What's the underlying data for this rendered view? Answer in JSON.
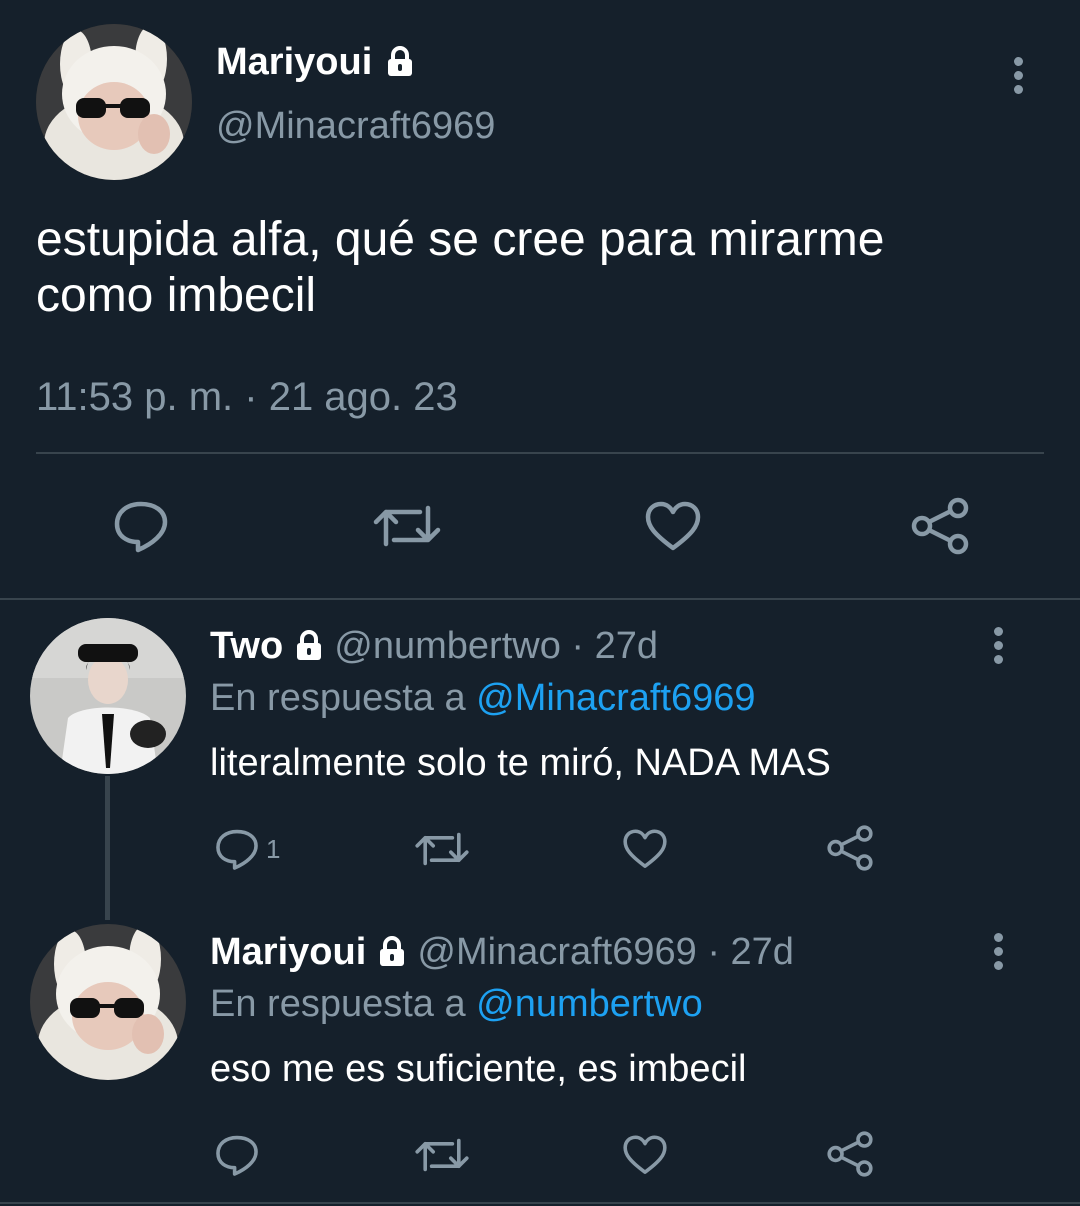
{
  "main_tweet": {
    "display_name": "Mariyoui",
    "handle": "@Minacraft6969",
    "text_line1": "estupida alfa, qué se cree para mirarme",
    "text_line2": "como imbecil",
    "timestamp": "11:53 p. m. · 21 ago. 23"
  },
  "replies": [
    {
      "display_name": "Two",
      "handle": "@numbertwo",
      "age": "· 27d",
      "reply_prefix": "En respuesta a",
      "reply_to": "@Minacraft6969",
      "text": "literalmente solo te miró, NADA MAS",
      "reply_count": "1"
    },
    {
      "display_name": "Mariyoui",
      "handle": "@Minacraft6969",
      "age": "· 27d",
      "reply_prefix": "En respuesta a",
      "reply_to": "@numbertwo",
      "text": "eso me es suficiente, es imbecil",
      "reply_count": ""
    }
  ],
  "colors": {
    "background": "#15202b",
    "muted": "#8899a6",
    "link": "#1da1f2",
    "divider": "#38444d"
  },
  "icons": [
    "lock-icon",
    "more-vertical-icon",
    "reply-icon",
    "retweet-icon",
    "like-icon",
    "share-icon"
  ]
}
